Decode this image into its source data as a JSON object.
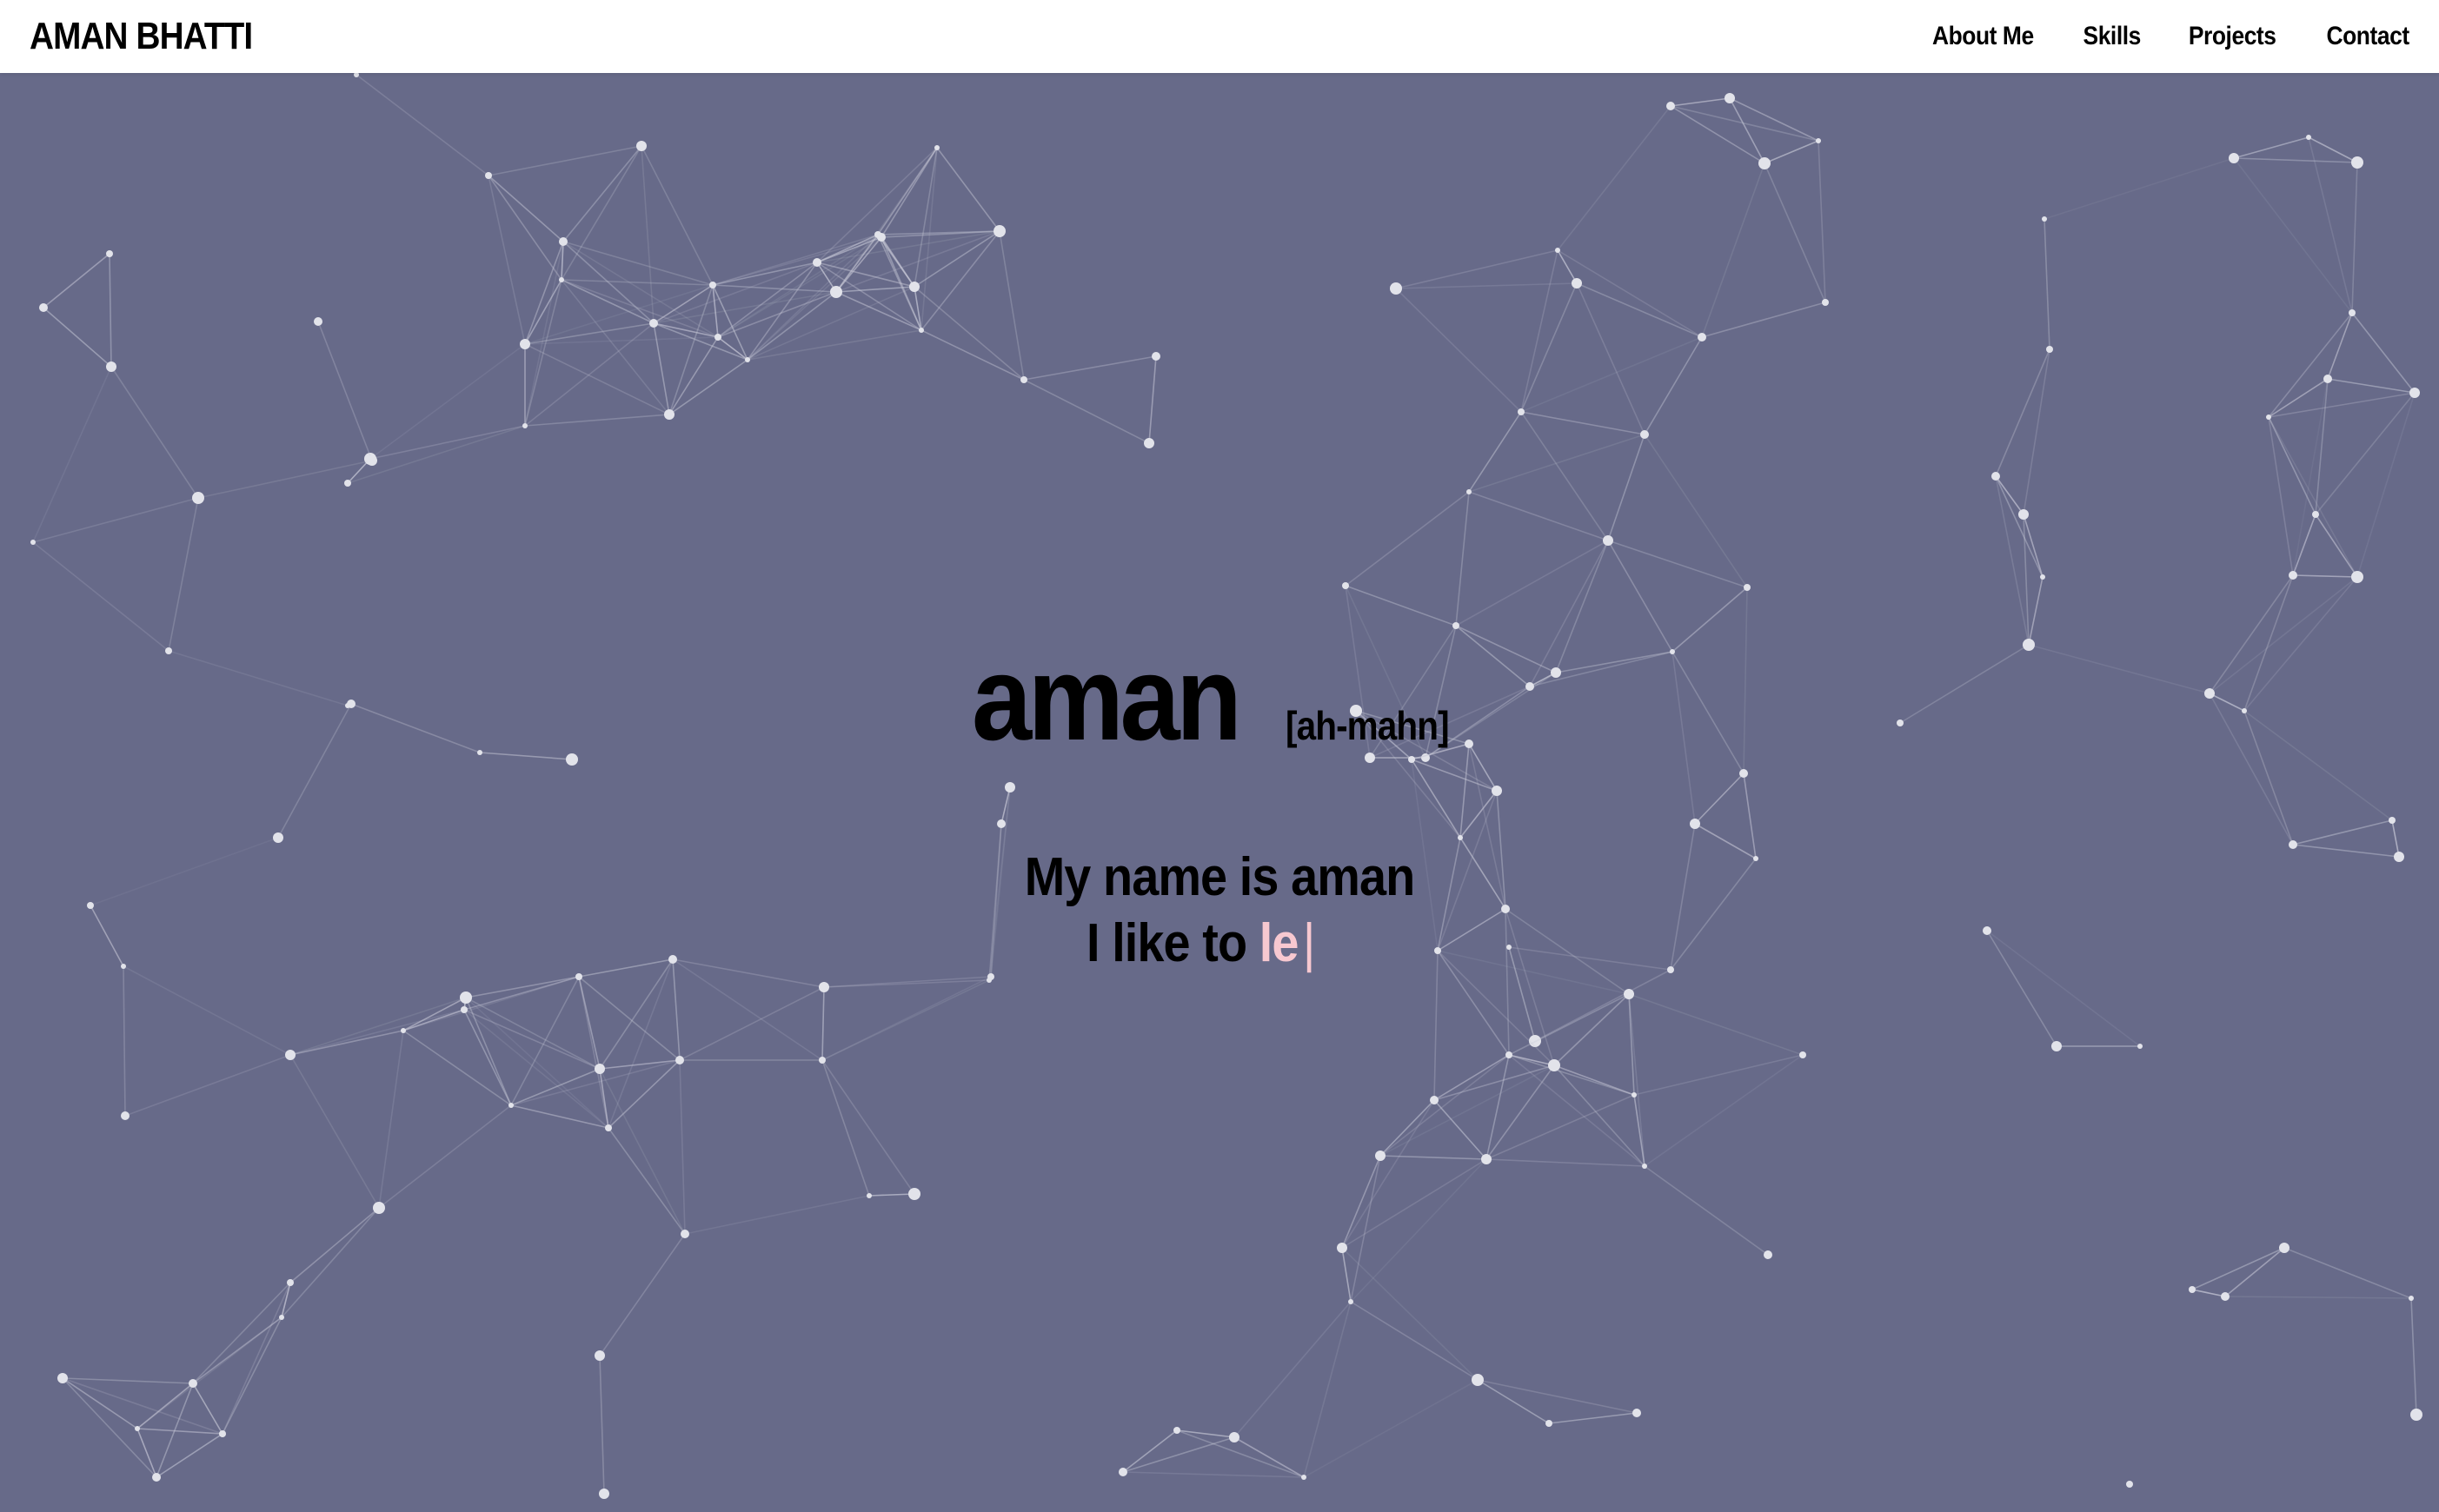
{
  "navbar": {
    "brand": "AMAN BHATTI",
    "links": [
      "About Me",
      "Skills",
      "Projects",
      "Contact"
    ]
  },
  "hero": {
    "title": "aman",
    "pronunciation": "[ah-mahn]",
    "subtitle": "My name is aman",
    "tagline_prefix": "I like to ",
    "tagline_typed": "le",
    "cursor": "|"
  },
  "colors": {
    "background": "#676a89",
    "accent_typed": "#f7c8d0",
    "navbar": "#ffffff",
    "network_lines": "#c9cad8",
    "network_nodes": "#e2e3ea"
  }
}
